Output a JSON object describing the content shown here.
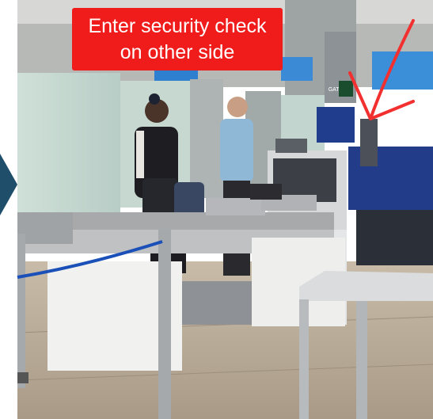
{
  "caption": {
    "line1": "Enter security check",
    "line2": "on other side",
    "background": "#f01c1c"
  },
  "annotation": {
    "arrow_color": "#f23030",
    "icon": "hand-drawn-arrow-icon"
  },
  "navigation": {
    "previous_icon": "chevron-left-icon"
  },
  "photo": {
    "sign_text": "GATE"
  }
}
